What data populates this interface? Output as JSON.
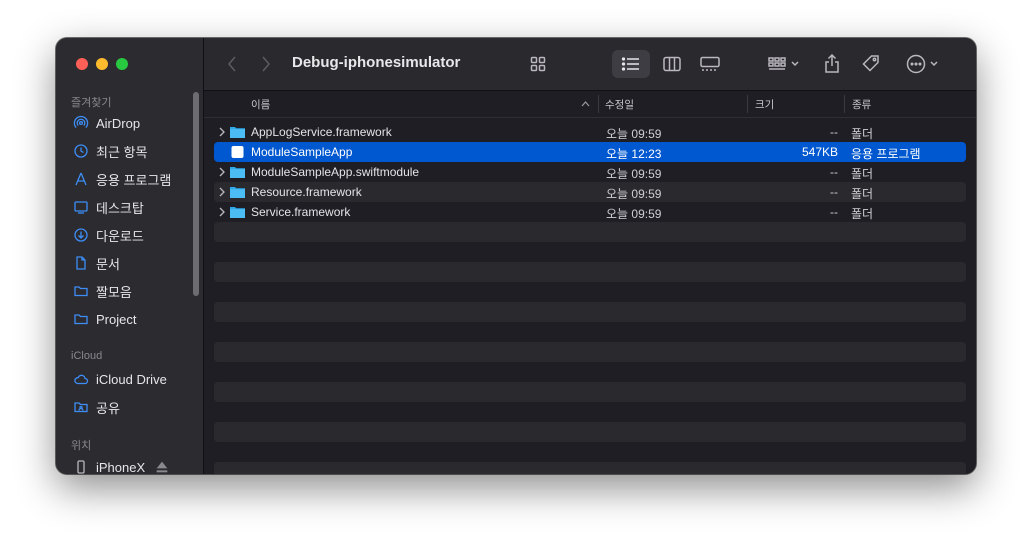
{
  "window": {
    "title": "Debug-iphonesimulator"
  },
  "sidebar": {
    "sections": [
      {
        "title": "즐겨찾기",
        "items": [
          {
            "label": "AirDrop",
            "icon": "airdrop-icon"
          },
          {
            "label": "최근 항목",
            "icon": "clock-icon"
          },
          {
            "label": "응용 프로그램",
            "icon": "applications-icon"
          },
          {
            "label": "데스크탑",
            "icon": "desktop-icon"
          },
          {
            "label": "다운로드",
            "icon": "download-icon"
          },
          {
            "label": "문서",
            "icon": "document-icon"
          },
          {
            "label": "짤모음",
            "icon": "folder-icon"
          },
          {
            "label": "Project",
            "icon": "folder-icon"
          }
        ]
      },
      {
        "title": "iCloud",
        "items": [
          {
            "label": "iCloud Drive",
            "icon": "cloud-icon"
          },
          {
            "label": "공유",
            "icon": "shared-folder-icon"
          }
        ]
      },
      {
        "title": "위치",
        "items": [
          {
            "label": "iPhoneX",
            "icon": "iphone-icon"
          }
        ]
      }
    ]
  },
  "columns": {
    "name": "이름",
    "date": "수정일",
    "size": "크기",
    "kind": "종류"
  },
  "files": [
    {
      "name": "AppLogService.framework",
      "date": "오늘 09:59",
      "size": "--",
      "kind": "폴더",
      "type": "folder",
      "selected": false
    },
    {
      "name": "ModuleSampleApp",
      "date": "오늘 12:23",
      "size": "547KB",
      "kind": "응용 프로그램",
      "type": "app",
      "selected": true
    },
    {
      "name": "ModuleSampleApp.swiftmodule",
      "date": "오늘 09:59",
      "size": "--",
      "kind": "폴더",
      "type": "folder",
      "selected": false
    },
    {
      "name": "Resource.framework",
      "date": "오늘 09:59",
      "size": "--",
      "kind": "폴더",
      "type": "folder",
      "selected": false
    },
    {
      "name": "Service.framework",
      "date": "오늘 09:59",
      "size": "--",
      "kind": "폴더",
      "type": "folder",
      "selected": false
    }
  ],
  "colors": {
    "selection": "#0058d0",
    "folder": "#2fa8ea"
  }
}
